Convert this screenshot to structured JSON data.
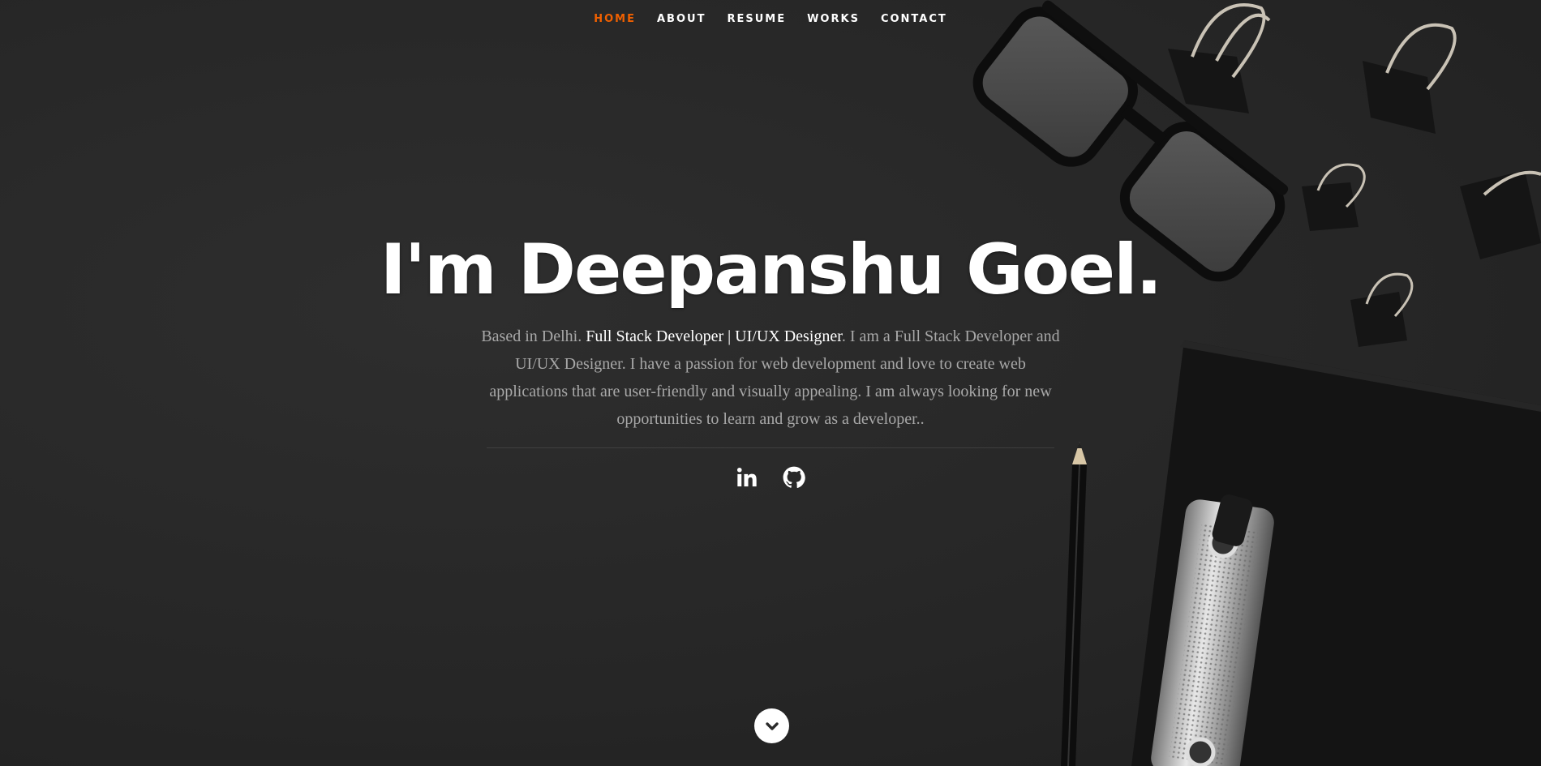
{
  "nav": {
    "items": [
      {
        "label": "HOME",
        "active": true
      },
      {
        "label": "ABOUT",
        "active": false
      },
      {
        "label": "RESUME",
        "active": false
      },
      {
        "label": "WORKS",
        "active": false
      },
      {
        "label": "CONTACT",
        "active": false
      }
    ]
  },
  "hero": {
    "title": "I'm Deepanshu Goel.",
    "desc_before": "Based in Delhi. ",
    "desc_highlight": "Full Stack Developer | UI/UX Designer",
    "desc_after": ". I am a Full Stack Developer and UI/UX Designer. I have a passion for web development and love to create web applications that are user-friendly and visually appealing. I am always looking for new opportunities to learn and grow as a developer.."
  },
  "social": {
    "icons": [
      "linkedin-icon",
      "github-icon"
    ]
  },
  "scroll": {
    "icon": "chevron-down-icon"
  },
  "colors": {
    "accent": "#F06000",
    "background": "#2b2b2b",
    "text": "#ffffff",
    "muted": "#a8a8a8"
  }
}
